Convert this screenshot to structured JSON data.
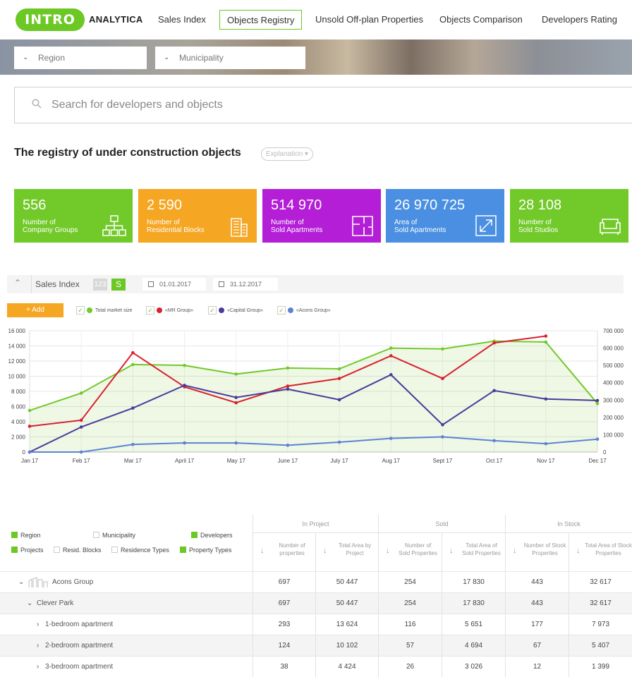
{
  "header": {
    "logo": "INTRO",
    "brand": "ANALYTICA",
    "nav": [
      "Sales Index",
      "Objects Registry",
      "Unsold Off-plan Properties",
      "Objects Comparison",
      "Developers Rating"
    ]
  },
  "filters": {
    "region_placeholder": "Region",
    "municipality_placeholder": "Municipality"
  },
  "search": {
    "placeholder": "Search for developers and objects"
  },
  "page": {
    "title": "The registry of under construction objects",
    "explanation": "Explanation"
  },
  "cards": [
    {
      "value": "556",
      "label1": "Number of",
      "label2": "Company Groups",
      "color": "#72c92a",
      "icon": "org-chart-icon"
    },
    {
      "value": "2 590",
      "label1": "Number of",
      "label2": "Residential Blocks",
      "color": "#f5a623",
      "icon": "building-icon"
    },
    {
      "value": "514 970",
      "label1": "Number of",
      "label2": "Sold Apartments",
      "color": "#b31ed6",
      "icon": "floorplan-icon"
    },
    {
      "value": "26 970 725",
      "label1": "Area of",
      "label2": "Sold Apartments",
      "color": "#4a8fe2",
      "icon": "expand-icon"
    },
    {
      "value": "28 108",
      "label1": "Number of",
      "label2": "Sold Studios",
      "color": "#72c92a",
      "icon": "sofa-icon"
    }
  ],
  "chart_toolbar": {
    "title": "Sales Index",
    "toggle_a": "123",
    "toggle_b": "S",
    "date_from": "01.01.2017",
    "date_to": "31.12.2017",
    "add_label": "+ Add"
  },
  "chart_data": {
    "type": "line",
    "categories": [
      "Jan 17",
      "Feb 17",
      "Mar 17",
      "April 17",
      "May 17",
      "June 17",
      "July 17",
      "Aug 17",
      "Sept 17",
      "Oct 17",
      "Nov 17",
      "Dec 17"
    ],
    "ylim": [
      0,
      16000
    ],
    "y2lim": [
      0,
      700000
    ],
    "yticks": [
      "0",
      "2 000",
      "4 000",
      "6 000",
      "8 000",
      "10 000",
      "12 000",
      "14 000",
      "16 000"
    ],
    "y2ticks": [
      "0",
      "100 000",
      "200 000",
      "300 000",
      "400 000",
      "500 000",
      "600 000",
      "700 000"
    ],
    "grid": true,
    "series": [
      {
        "name": "Total market size",
        "axis": "right",
        "color": "#72c92a",
        "area": true,
        "values": [
          240000,
          340000,
          505000,
          500000,
          450000,
          485000,
          480000,
          600000,
          595000,
          640000,
          635000,
          280000
        ]
      },
      {
        "name": "«MR Group»",
        "axis": "left",
        "color": "#d9212e",
        "values": [
          3400,
          4200,
          13100,
          8600,
          6500,
          8700,
          9700,
          12700,
          9700,
          14400,
          15300,
          null
        ]
      },
      {
        "name": "«Capital Group»",
        "axis": "left",
        "color": "#4b3a9c",
        "values": [
          0,
          3300,
          5800,
          8800,
          7200,
          8300,
          6900,
          10200,
          3600,
          8100,
          7000,
          6800
        ]
      },
      {
        "name": "«Acons Group»",
        "axis": "left",
        "color": "#5a83d6",
        "values": [
          0,
          0,
          1000,
          1200,
          1200,
          900,
          1300,
          1800,
          2000,
          1500,
          1100,
          1700
        ]
      }
    ]
  },
  "table": {
    "checks": [
      {
        "label": "Region",
        "checked": true
      },
      {
        "label": "Municipality",
        "checked": false
      },
      {
        "label": "Developers",
        "checked": true
      },
      {
        "label": "Projects",
        "checked": true
      },
      {
        "label": "Resid. Blocks",
        "checked": false
      },
      {
        "label": "Residence Types",
        "checked": false
      },
      {
        "label": "Property Types",
        "checked": true
      }
    ],
    "groups": [
      "In Project",
      "Sold",
      "In Stock"
    ],
    "columns": [
      [
        "Number of",
        "properties"
      ],
      [
        "Total Area by",
        "Project"
      ],
      [
        "Number of",
        "Sold Properties"
      ],
      [
        "Total Area of",
        "Sold Properties"
      ],
      [
        "Number of Stock",
        "Properties"
      ],
      [
        "Total Area of Stock",
        "Properties"
      ]
    ],
    "rows": [
      {
        "name": "Acons Group",
        "cells": [
          "697",
          "50 447",
          "254",
          "17 830",
          "443",
          "32 617"
        ]
      },
      {
        "name": "Clever Park",
        "cells": [
          "697",
          "50 447",
          "254",
          "17 830",
          "443",
          "32 617"
        ]
      },
      {
        "name": "1-bedroom apartment",
        "cells": [
          "293",
          "13 624",
          "116",
          "5 651",
          "177",
          "7 973"
        ]
      },
      {
        "name": "2-bedroom apartment",
        "cells": [
          "124",
          "10 102",
          "57",
          "4 694",
          "67",
          "5 407"
        ]
      },
      {
        "name": "3-bedroom apartment",
        "cells": [
          "38",
          "4 424",
          "26",
          "3 026",
          "12",
          "1 399"
        ]
      }
    ]
  }
}
